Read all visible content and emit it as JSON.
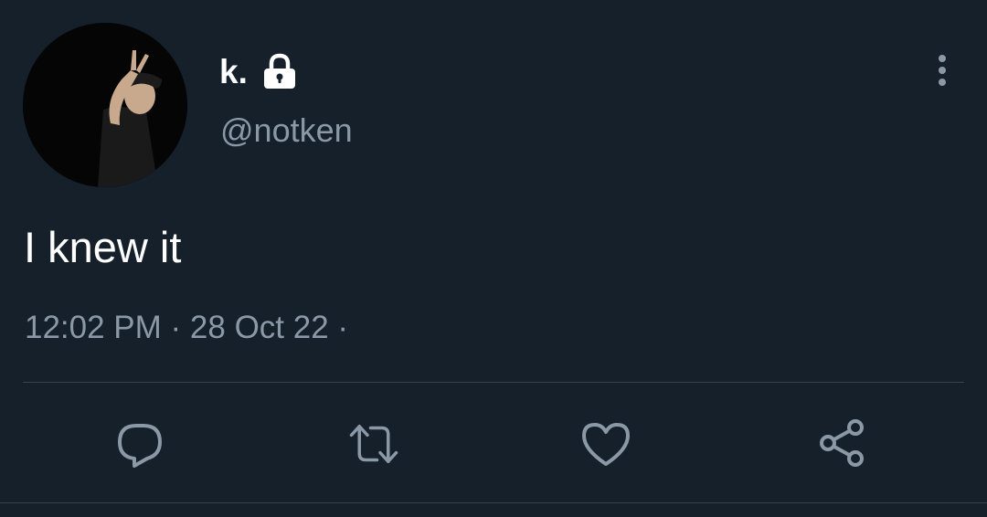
{
  "tweet": {
    "display_name": "k.",
    "handle": "@notken",
    "text": "I knew it",
    "time": "12:02 PM",
    "separator": " · ",
    "date": "28 Oct 22",
    "trailing_separator": " ·"
  },
  "icons": {
    "avatar": "profile-photo",
    "lock": "lock-icon",
    "more": "more-vertical-icon",
    "reply": "reply-icon",
    "retweet": "retweet-icon",
    "like": "heart-icon",
    "share": "share-icon"
  },
  "colors": {
    "background": "#15202b",
    "primary_text": "#ffffff",
    "secondary_text": "#8b98a5",
    "divider": "#38444d"
  }
}
